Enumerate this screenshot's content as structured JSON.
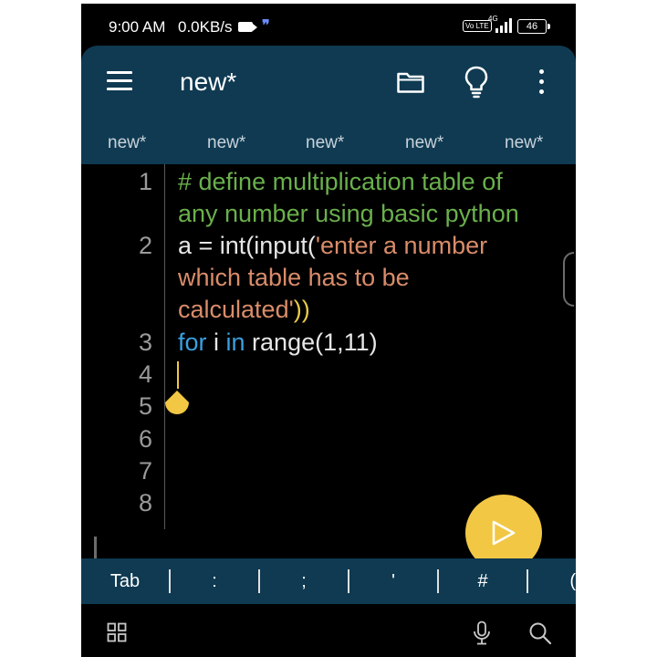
{
  "status_bar": {
    "time": "9:00 AM",
    "network_speed": "0.0KB/s",
    "volte": "Vo LTE",
    "network_type": "4G",
    "battery": "46"
  },
  "app_bar": {
    "menu_icon": "hamburger-menu-icon",
    "title": "new*",
    "folder_icon": "folder-icon",
    "bulb_icon": "lightbulb-icon",
    "more_icon": "more-vertical-icon"
  },
  "tabs": [
    {
      "label": "new*"
    },
    {
      "label": "new*"
    },
    {
      "label": "new*"
    },
    {
      "label": "new*"
    },
    {
      "label": "new*"
    }
  ],
  "editor": {
    "line_numbers": [
      "1",
      "2",
      "3",
      "4",
      "5",
      "6",
      "7",
      "8"
    ],
    "code": {
      "l1a": "# define multiplication table of",
      "l1b": "any number using basic python",
      "l2_pre": "a = int(input(",
      "l2_str1": "'enter a number",
      "l2_str2": "which table has to be",
      "l2_str3": "calculated'",
      "l2_close": "))",
      "l3_for": "for",
      "l3_mid": " i ",
      "l3_in": "in",
      "l3_rest": " range(1,11)"
    },
    "run_icon": "play-icon"
  },
  "symbol_bar": [
    "Tab",
    ":",
    ";",
    "'",
    "#",
    "("
  ],
  "bottom_bar": {
    "grid_icon": "grid-icon",
    "mic_icon": "microphone-icon",
    "search_icon": "search-icon"
  },
  "colors": {
    "header": "#0f3a52",
    "accent": "#f2c744",
    "comment": "#6ab04c",
    "string": "#d98c6a",
    "keyword": "#3aa0e0"
  }
}
